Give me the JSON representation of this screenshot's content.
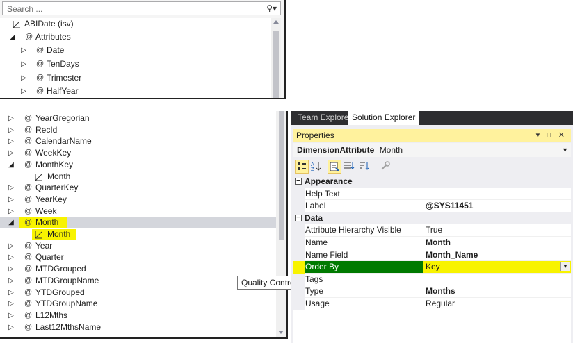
{
  "top_tree": {
    "search_placeholder": "Search ...",
    "rows": [
      {
        "label": "ABIDate (isv)",
        "icon": "table-icon"
      },
      {
        "label": "Attributes",
        "icon": "attribute-icon"
      },
      {
        "label": "Date",
        "icon": "attribute-icon"
      },
      {
        "label": "TenDays",
        "icon": "attribute-icon"
      },
      {
        "label": "Trimester",
        "icon": "attribute-icon"
      },
      {
        "label": "HalfYear",
        "icon": "attribute-icon"
      }
    ]
  },
  "bottom_tree": {
    "rows": [
      {
        "label": "YearGregorian"
      },
      {
        "label": "RecId"
      },
      {
        "label": "CalendarName"
      },
      {
        "label": "WeekKey"
      },
      {
        "label": "MonthKey"
      },
      {
        "label": "Month"
      },
      {
        "label": "QuarterKey"
      },
      {
        "label": "YearKey"
      },
      {
        "label": "Week"
      },
      {
        "label": "Month"
      },
      {
        "label": "Month"
      },
      {
        "label": "Year"
      },
      {
        "label": "Quarter"
      },
      {
        "label": "MTDGrouped"
      },
      {
        "label": "MTDGroupName"
      },
      {
        "label": "YTDGrouped"
      },
      {
        "label": "YTDGroupName"
      },
      {
        "label": "L12Mths"
      },
      {
        "label": "Last12MthsName"
      }
    ]
  },
  "tooltip": "Quality Control",
  "right_panel": {
    "tabs": [
      "Team Explorer",
      "Solution Explorer"
    ],
    "properties_title": "Properties",
    "title_controls": "▾ ⊓ ✕",
    "object_type": "DimensionAttribute",
    "object_name": "Month",
    "categories": {
      "appearance": "Appearance",
      "data": "Data"
    },
    "appearance_props": [
      {
        "name": "Help Text",
        "value": ""
      },
      {
        "name": "Label",
        "value": "@SYS11451"
      }
    ],
    "data_props": [
      {
        "name": "Attribute Hierarchy Visible",
        "value": "True"
      },
      {
        "name": "Name",
        "value": "Month"
      },
      {
        "name": "Name Field",
        "value": "Month_Name"
      },
      {
        "name": "Order By",
        "value": "Key"
      },
      {
        "name": "Tags",
        "value": ""
      },
      {
        "name": "Type",
        "value": "Months"
      },
      {
        "name": "Usage",
        "value": "Regular"
      }
    ]
  },
  "colors": {
    "highlight_yellow": "#f8f300",
    "selected_green": "#007a00",
    "title_yellow": "#fff29d",
    "tab_dark": "#2d2d30"
  }
}
